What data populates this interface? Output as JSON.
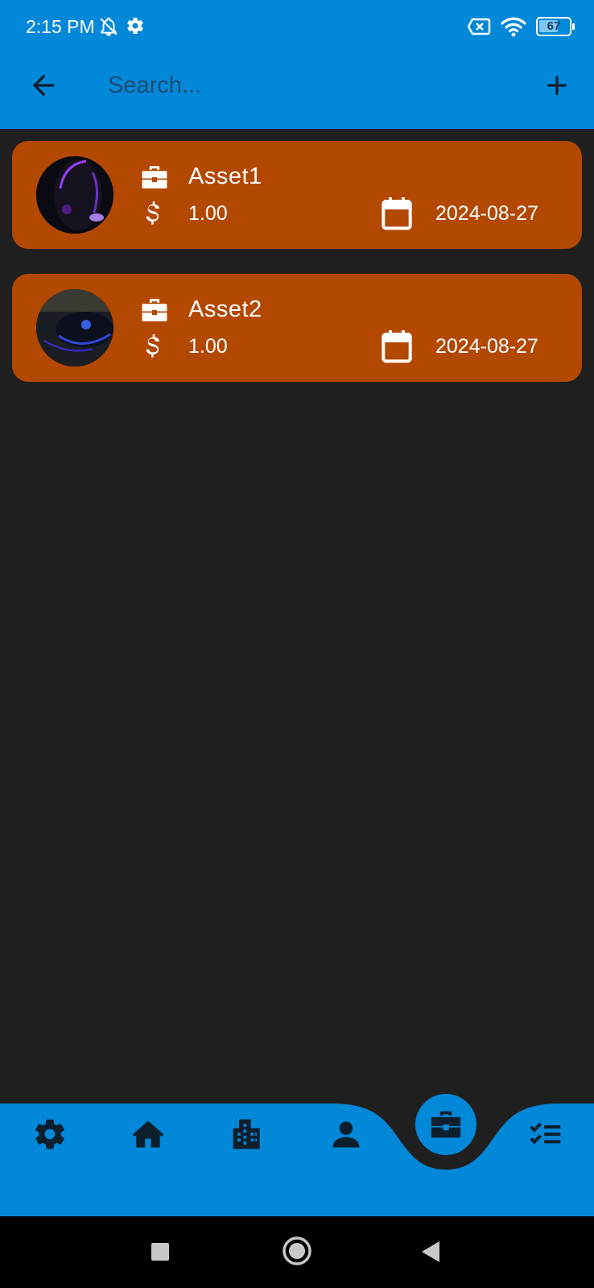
{
  "status_bar": {
    "time": "2:15 PM",
    "battery": "67",
    "battery_level": 0.67,
    "icons": [
      "bell-off-icon",
      "gear-icon",
      "no-sim-icon",
      "wifi-icon",
      "battery-icon"
    ]
  },
  "app_bar": {
    "search_placeholder": "Search...",
    "icons": [
      "back-arrow-icon",
      "plus-icon"
    ]
  },
  "assets": [
    {
      "name": "Asset1",
      "price": "1.00",
      "date": "2024-08-27"
    },
    {
      "name": "Asset2",
      "price": "1.00",
      "date": "2024-08-27"
    }
  ],
  "bottom_nav": {
    "items": [
      "gear-icon",
      "home-icon",
      "buildings-icon",
      "person-icon",
      "briefcase-icon",
      "checklist-icon"
    ],
    "active": "briefcase-icon"
  },
  "colors": {
    "primary": "#0288d8",
    "card": "#b34800",
    "background": "#1f1f1f",
    "icon_dark": "#0d1f2d"
  }
}
